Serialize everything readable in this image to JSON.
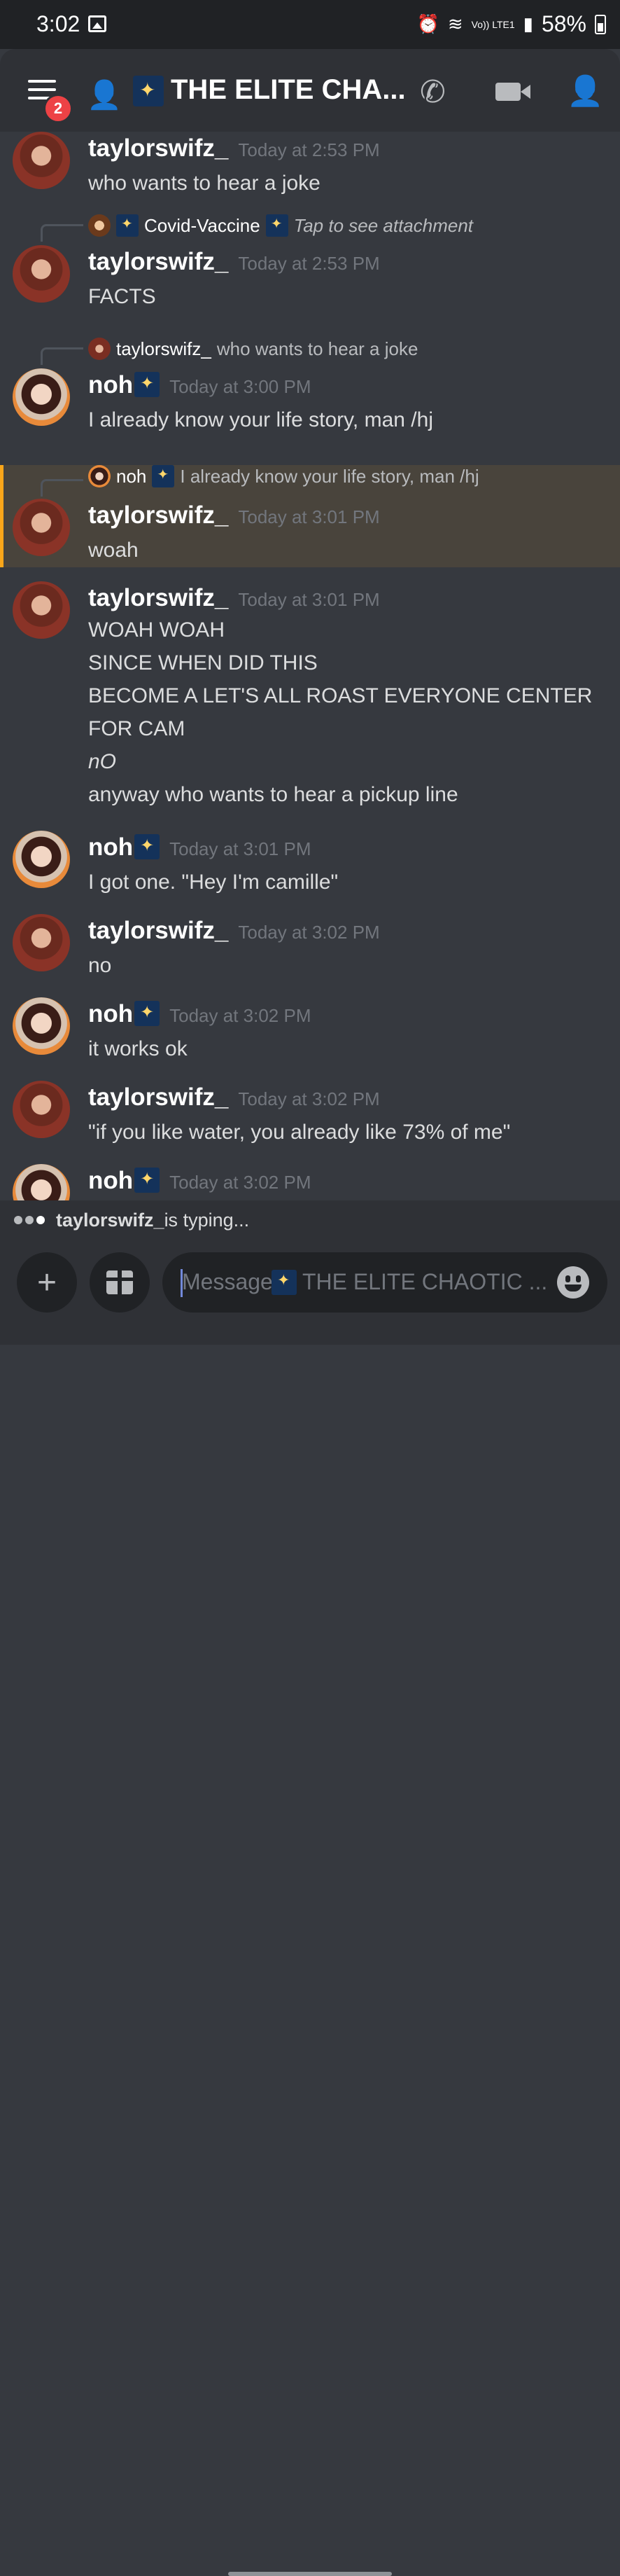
{
  "status_bar": {
    "time": "3:02",
    "network": "Vo)) LTE1",
    "battery": "58%"
  },
  "header": {
    "unread_badge": "2",
    "channel_title": "THE ELITE CHA..."
  },
  "messages": [
    {
      "author": "taylorswifz_",
      "time": "Today at 2:53 PM",
      "lines": [
        "who wants to hear a joke"
      ]
    },
    {
      "reply_to": {
        "author": "Covid-Vaccine",
        "text": "Tap to see attachment"
      },
      "author": "taylorswifz_",
      "time": "Today at 2:53 PM",
      "lines": [
        "FACTS"
      ]
    },
    {
      "reply_to": {
        "author": "taylorswifz_",
        "text": "who wants to hear a joke"
      },
      "author": "noh",
      "time": "Today at 3:00 PM",
      "lines": [
        "I already know your life story, man /hj"
      ]
    },
    {
      "reply_to": {
        "author": "noh",
        "text": "I already know your life story, man /hj"
      },
      "author": "taylorswifz_",
      "time": "Today at 3:01 PM",
      "lines": [
        "woah"
      ],
      "highlighted": true
    },
    {
      "author": "taylorswifz_",
      "time": "Today at 3:01 PM",
      "lines": [
        "WOAH WOAH",
        "SINCE WHEN DID THIS",
        "BECOME A LET'S ALL ROAST EVERYONE CENTER",
        "FOR CAM",
        "nO",
        "anyway who wants to hear a pickup line"
      ]
    },
    {
      "author": "noh",
      "time": "Today at 3:01 PM",
      "lines": [
        "I got one. \"Hey I'm camille\""
      ]
    },
    {
      "author": "taylorswifz_",
      "time": "Today at 3:02 PM",
      "lines": [
        "no"
      ]
    },
    {
      "author": "noh",
      "time": "Today at 3:02 PM",
      "lines": [
        "it works ok"
      ]
    },
    {
      "author": "taylorswifz_",
      "time": "Today at 3:02 PM",
      "lines": [
        "\"if you like water, you already like 73% of me\""
      ]
    },
    {
      "author": "noh",
      "time": "Today at 3:02 PM",
      "lines": []
    }
  ],
  "typing": {
    "name": "taylorswifz_",
    "suffix": " is typing..."
  },
  "composer": {
    "placeholder_start": "Message",
    "placeholder_channel": "THE ELITE CHAOTIC ..."
  }
}
